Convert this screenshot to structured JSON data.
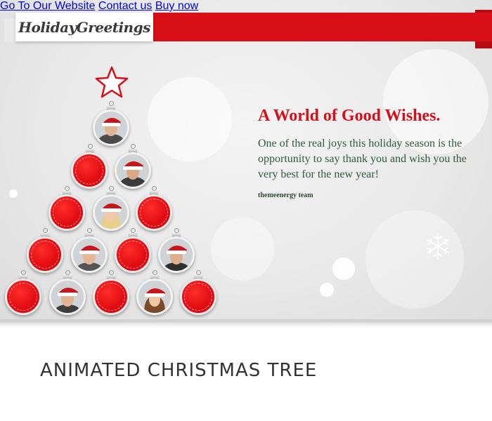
{
  "brand": {
    "logo_text": "HolidayGreetings"
  },
  "nav": {
    "items": [
      {
        "label": "Go To Our Website"
      },
      {
        "label": "Contact us"
      },
      {
        "label": "Buy now"
      }
    ]
  },
  "message": {
    "headline": "A World of Good Wishes.",
    "body": "One of the real joys this holiday season is the opportunity to say thank you and wish you the very best for the new year!",
    "signature": "themeenergy team"
  },
  "caption": {
    "title": "ANIMATED CHRISTMAS TREE"
  },
  "colors": {
    "accent": "#d80f16",
    "headline": "#d6101a",
    "body_text": "#2f5a3d"
  },
  "icons": {
    "tree_top": "star-icon",
    "decor": "snowflake-icon"
  }
}
